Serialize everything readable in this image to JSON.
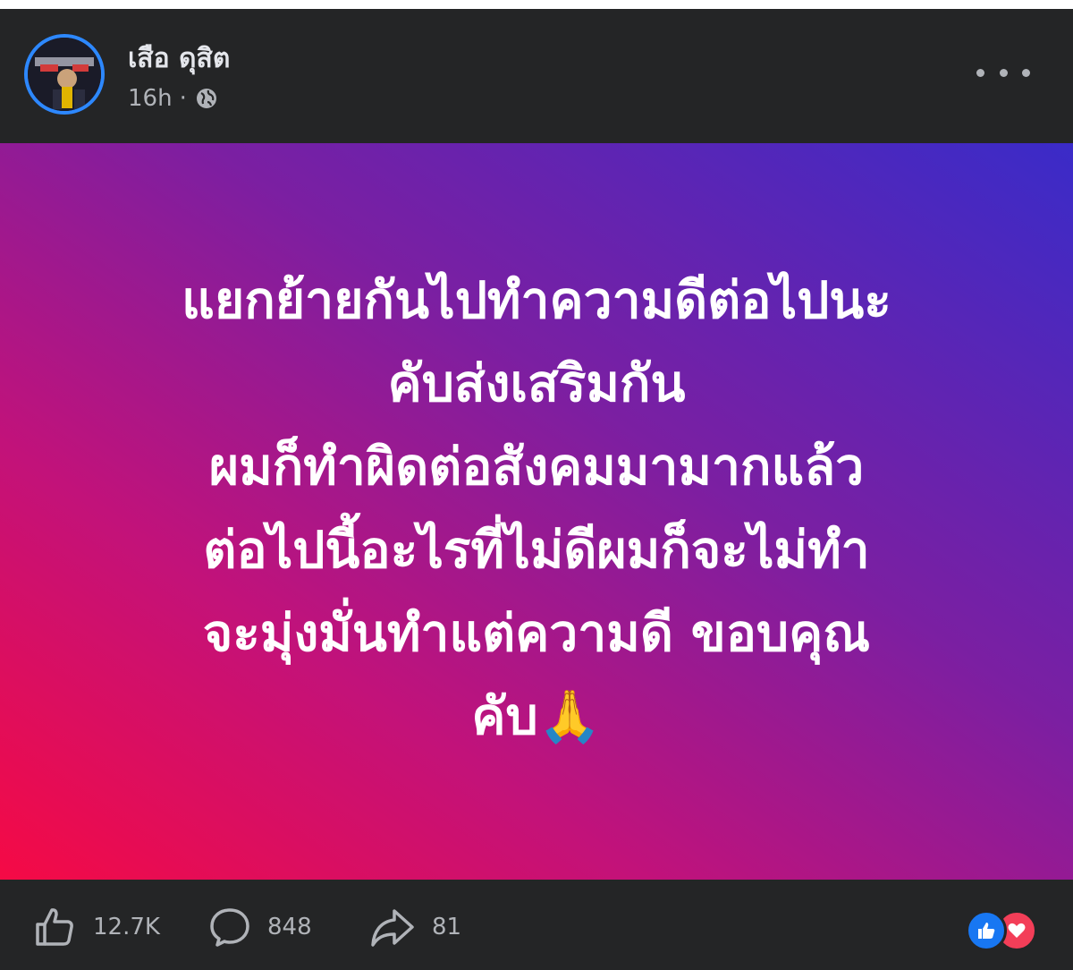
{
  "post": {
    "author_name": "เสือ ดุสิต",
    "timestamp": "16h",
    "separator": "·",
    "audience_icon": "globe-icon",
    "menu_icon": "more-horizontal-icon"
  },
  "status": {
    "text": "แยกย้ายกันไปทำความดีต่อไปนะ\nคับส่งเสริมกัน\nผมก็ทำผิดต่อสังคมมามากแล้ว\nต่อไปนี้อะไรที่ไม่ดีผมก็จะไม่ทำ\nจะมุ่งมั่นทำแต่ความดี ขอบคุณ\nคับ🙏",
    "background_gradient": [
      "#3a2bc8",
      "#7b1fa2",
      "#c2127a",
      "#f50a45"
    ]
  },
  "footer": {
    "likes": "12.7K",
    "comments": "848",
    "shares": "81",
    "like_icon": "thumbs-up-icon",
    "comment_icon": "comment-bubble-icon",
    "share_icon": "share-arrow-icon",
    "reaction_icons": [
      "like-reaction-icon",
      "love-reaction-icon"
    ]
  },
  "colors": {
    "card_bg": "#242526",
    "primary_text": "#e4e6eb",
    "secondary_text": "#b0b3b8",
    "accent": "#2d88ff",
    "like_blue": "#1877f2",
    "love_red": "#f33e58"
  }
}
